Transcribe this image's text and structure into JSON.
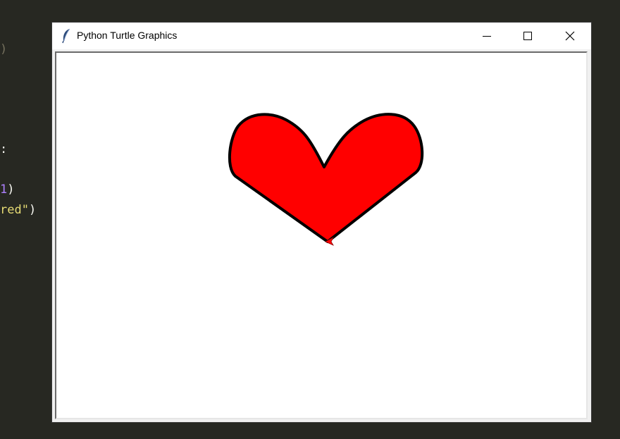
{
  "editor": {
    "line1": ")",
    "line2": ":",
    "line3_num": "1",
    "line3_paren": ")",
    "line4_str": "red\"",
    "line4_paren": ")"
  },
  "window": {
    "title": "Python Turtle Graphics",
    "buttons": {
      "minimize_icon": "minimize-icon",
      "maximize_icon": "maximize-icon",
      "close_icon": "close-icon"
    },
    "app_icon": "feather-icon"
  },
  "drawing": {
    "shape": "heart",
    "fill_color": "#ff0000",
    "outline_color": "#000000",
    "turtle_color": "#ff0000"
  }
}
